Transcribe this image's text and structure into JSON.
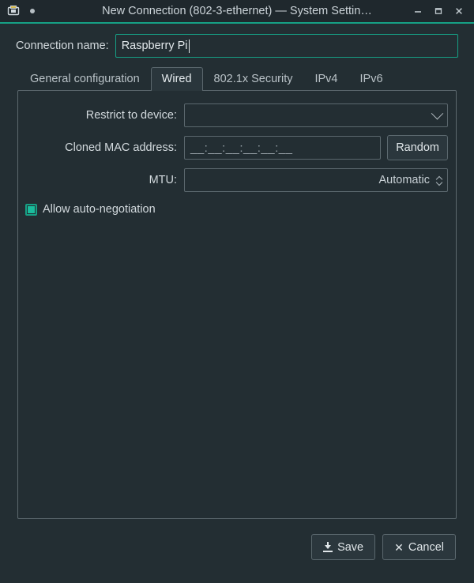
{
  "window": {
    "title": "New Connection (802-3-ethernet) — System Settin…",
    "icon": "ethernet-port-icon",
    "modified_dot": "•",
    "controls": {
      "minimize": "—",
      "maximize": "▣",
      "close": "✕"
    },
    "accent_color": "#16a085",
    "background_color": "#232e33",
    "titlebar_color": "#1f282d"
  },
  "connection": {
    "name_label": "Connection name:",
    "name_value": "Raspberry Pi",
    "name_placeholder": ""
  },
  "tabs": [
    {
      "label": "General configuration",
      "active": false
    },
    {
      "label": "Wired",
      "active": true
    },
    {
      "label": "802.1x Security",
      "active": false
    },
    {
      "label": "IPv4",
      "active": false
    },
    {
      "label": "IPv6",
      "active": false
    }
  ],
  "wired": {
    "restrict_device": {
      "label": "Restrict to device:",
      "value": "",
      "icon": "chevron-down-icon"
    },
    "cloned_mac": {
      "label": "Cloned MAC address:",
      "value": "",
      "placeholder": "__:__:__:__:__:__",
      "button_label": "Random"
    },
    "mtu": {
      "label": "MTU:",
      "value": "Automatic",
      "icon": "spinner-arrows-icon"
    },
    "auto_negotiation": {
      "label": "Allow auto-negotiation",
      "checked": true,
      "check_color": "#1abc9c"
    }
  },
  "footer": {
    "save_label": "Save",
    "save_icon": "download-arrow-icon",
    "cancel_label": "Cancel",
    "cancel_icon": "close-x-icon"
  }
}
